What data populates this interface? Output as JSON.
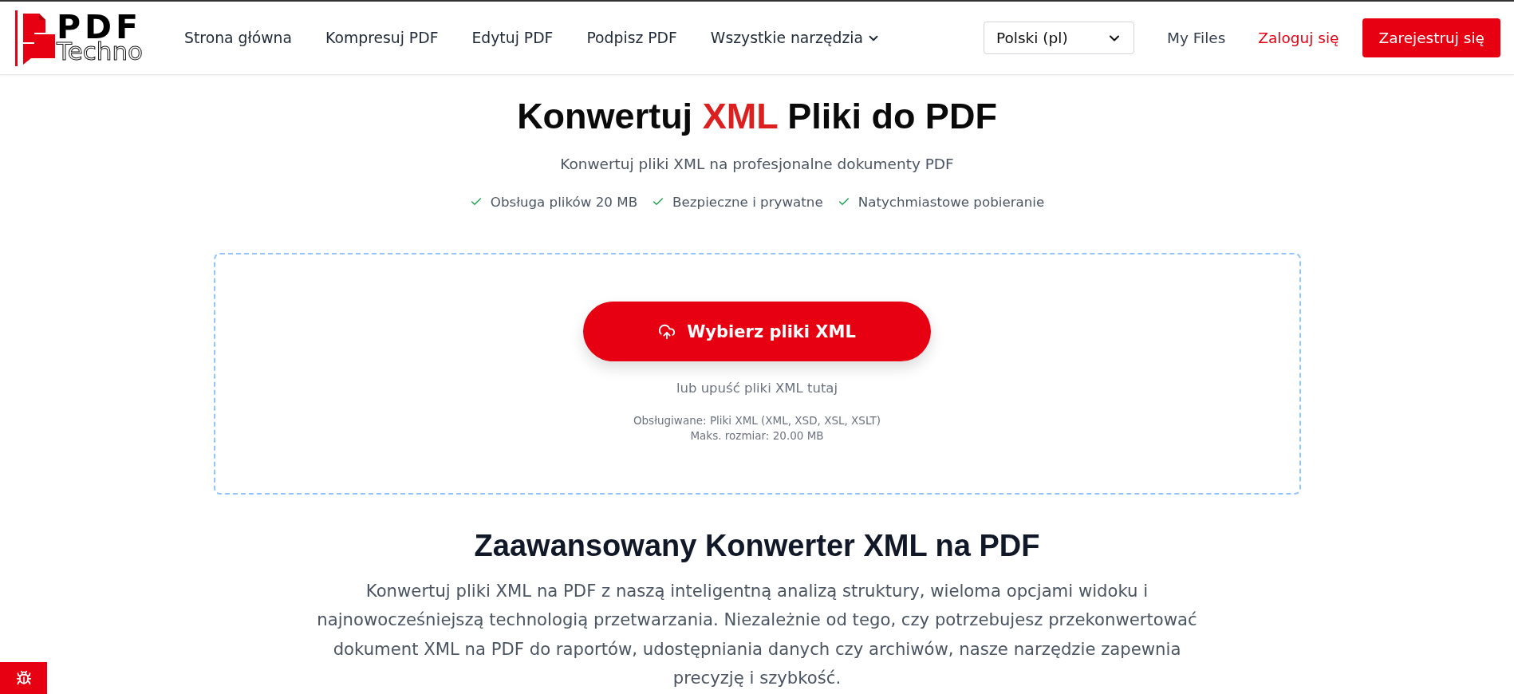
{
  "header": {
    "logo": {
      "primary": "PDF",
      "secondary": "Techno"
    },
    "nav": [
      {
        "label": "Strona główna",
        "dropdown": false
      },
      {
        "label": "Kompresuj PDF",
        "dropdown": false
      },
      {
        "label": "Edytuj PDF",
        "dropdown": false
      },
      {
        "label": "Podpisz PDF",
        "dropdown": false
      },
      {
        "label": "Wszystkie narzędzia",
        "dropdown": true
      }
    ],
    "language_select": {
      "value": "Polski (pl)"
    },
    "my_files": "My Files",
    "login": "Zaloguj się",
    "register": "Zarejestruj się"
  },
  "hero": {
    "title": [
      {
        "text": "Konwertuj",
        "highlighted": false
      },
      {
        "text": "XML",
        "highlighted": true
      },
      {
        "text": "Pliki do PDF",
        "highlighted": false
      }
    ],
    "subtitle": "Konwertuj pliki XML na profesjonalne dokumenty PDF",
    "features": [
      "Obsługa plików 20 MB",
      "Bezpieczne i prywatne",
      "Natychmiastowe pobieranie"
    ]
  },
  "upload": {
    "button": "Wybierz pliki XML",
    "hint": "lub upuść pliki XML tutaj",
    "formats": "Obsługiwane: Pliki XML (XML, XSD, XSL, XSLT)",
    "max_size": "Maks. rozmiar: 20.00 MB"
  },
  "about": {
    "heading": "Zaawansowany Konwerter XML na PDF",
    "text": "Konwertuj pliki XML na PDF z naszą inteligentną analizą struktury, wieloma opcjami widoku i najnowocześniejszą technologią przetwarzania. Niezależnie od tego, czy potrzebujesz przekonwertować dokument XML na PDF do raportów, udostępniania danych czy archiwów, nasze narzędzie zapewnia precyzję i szybkość."
  }
}
